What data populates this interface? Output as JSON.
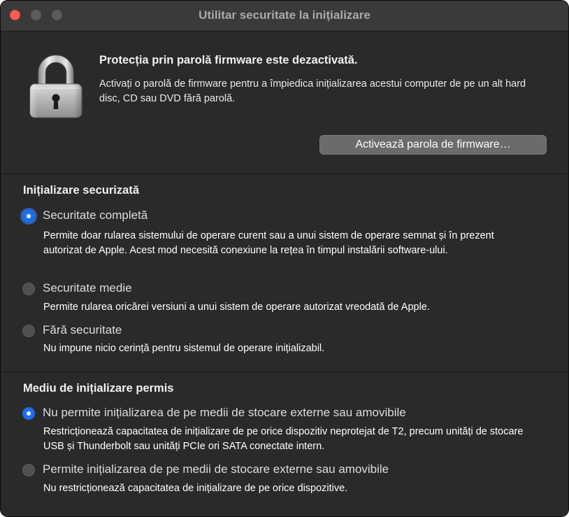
{
  "window": {
    "title": "Utilitar securitate la inițializare"
  },
  "firmware": {
    "heading": "Protecția prin parolă firmware este dezactivată.",
    "description": "Activați o parolă de firmware pentru a împiedica inițializarea acestui computer de pe un alt hard disc, CD sau DVD fără parolă.",
    "button_label": "Activează parola de firmware…",
    "icon": "lock-icon"
  },
  "secure_boot": {
    "title": "Inițializare securizată",
    "options": [
      {
        "label": "Securitate completă",
        "description": "Permite doar rularea sistemului de operare curent sau a unui sistem de operare semnat și în prezent autorizat de Apple. Acest mod necesită conexiune la rețea în timpul instalării software-ului.",
        "selected": true
      },
      {
        "label": "Securitate medie",
        "description": "Permite rularea oricărei versiuni a unui sistem de operare autorizat vreodată de Apple.",
        "selected": false
      },
      {
        "label": "Fără securitate",
        "description": "Nu impune nicio cerință pentru sistemul de operare inițializabil.",
        "selected": false
      }
    ]
  },
  "boot_media": {
    "title": "Mediu de inițializare permis",
    "options": [
      {
        "label": "Nu permite inițializarea de pe medii de stocare externe sau amovibile",
        "description": "Restricționează capacitatea de inițializare de pe orice dispozitiv neprotejat de T2, precum unități de stocare USB și Thunderbolt sau unități PCIe ori SATA conectate intern.",
        "selected": true
      },
      {
        "label": "Permite inițializarea de pe medii de stocare externe sau amovibile",
        "description": "Nu restricționează capacitatea de inițializare de pe orice dispozitive.",
        "selected": false
      }
    ]
  },
  "colors": {
    "window_bg": "#2a2a2a",
    "titlebar_bg": "#3a3a3a",
    "accent": "#1e6cf0",
    "close_button": "#ff5f57"
  }
}
